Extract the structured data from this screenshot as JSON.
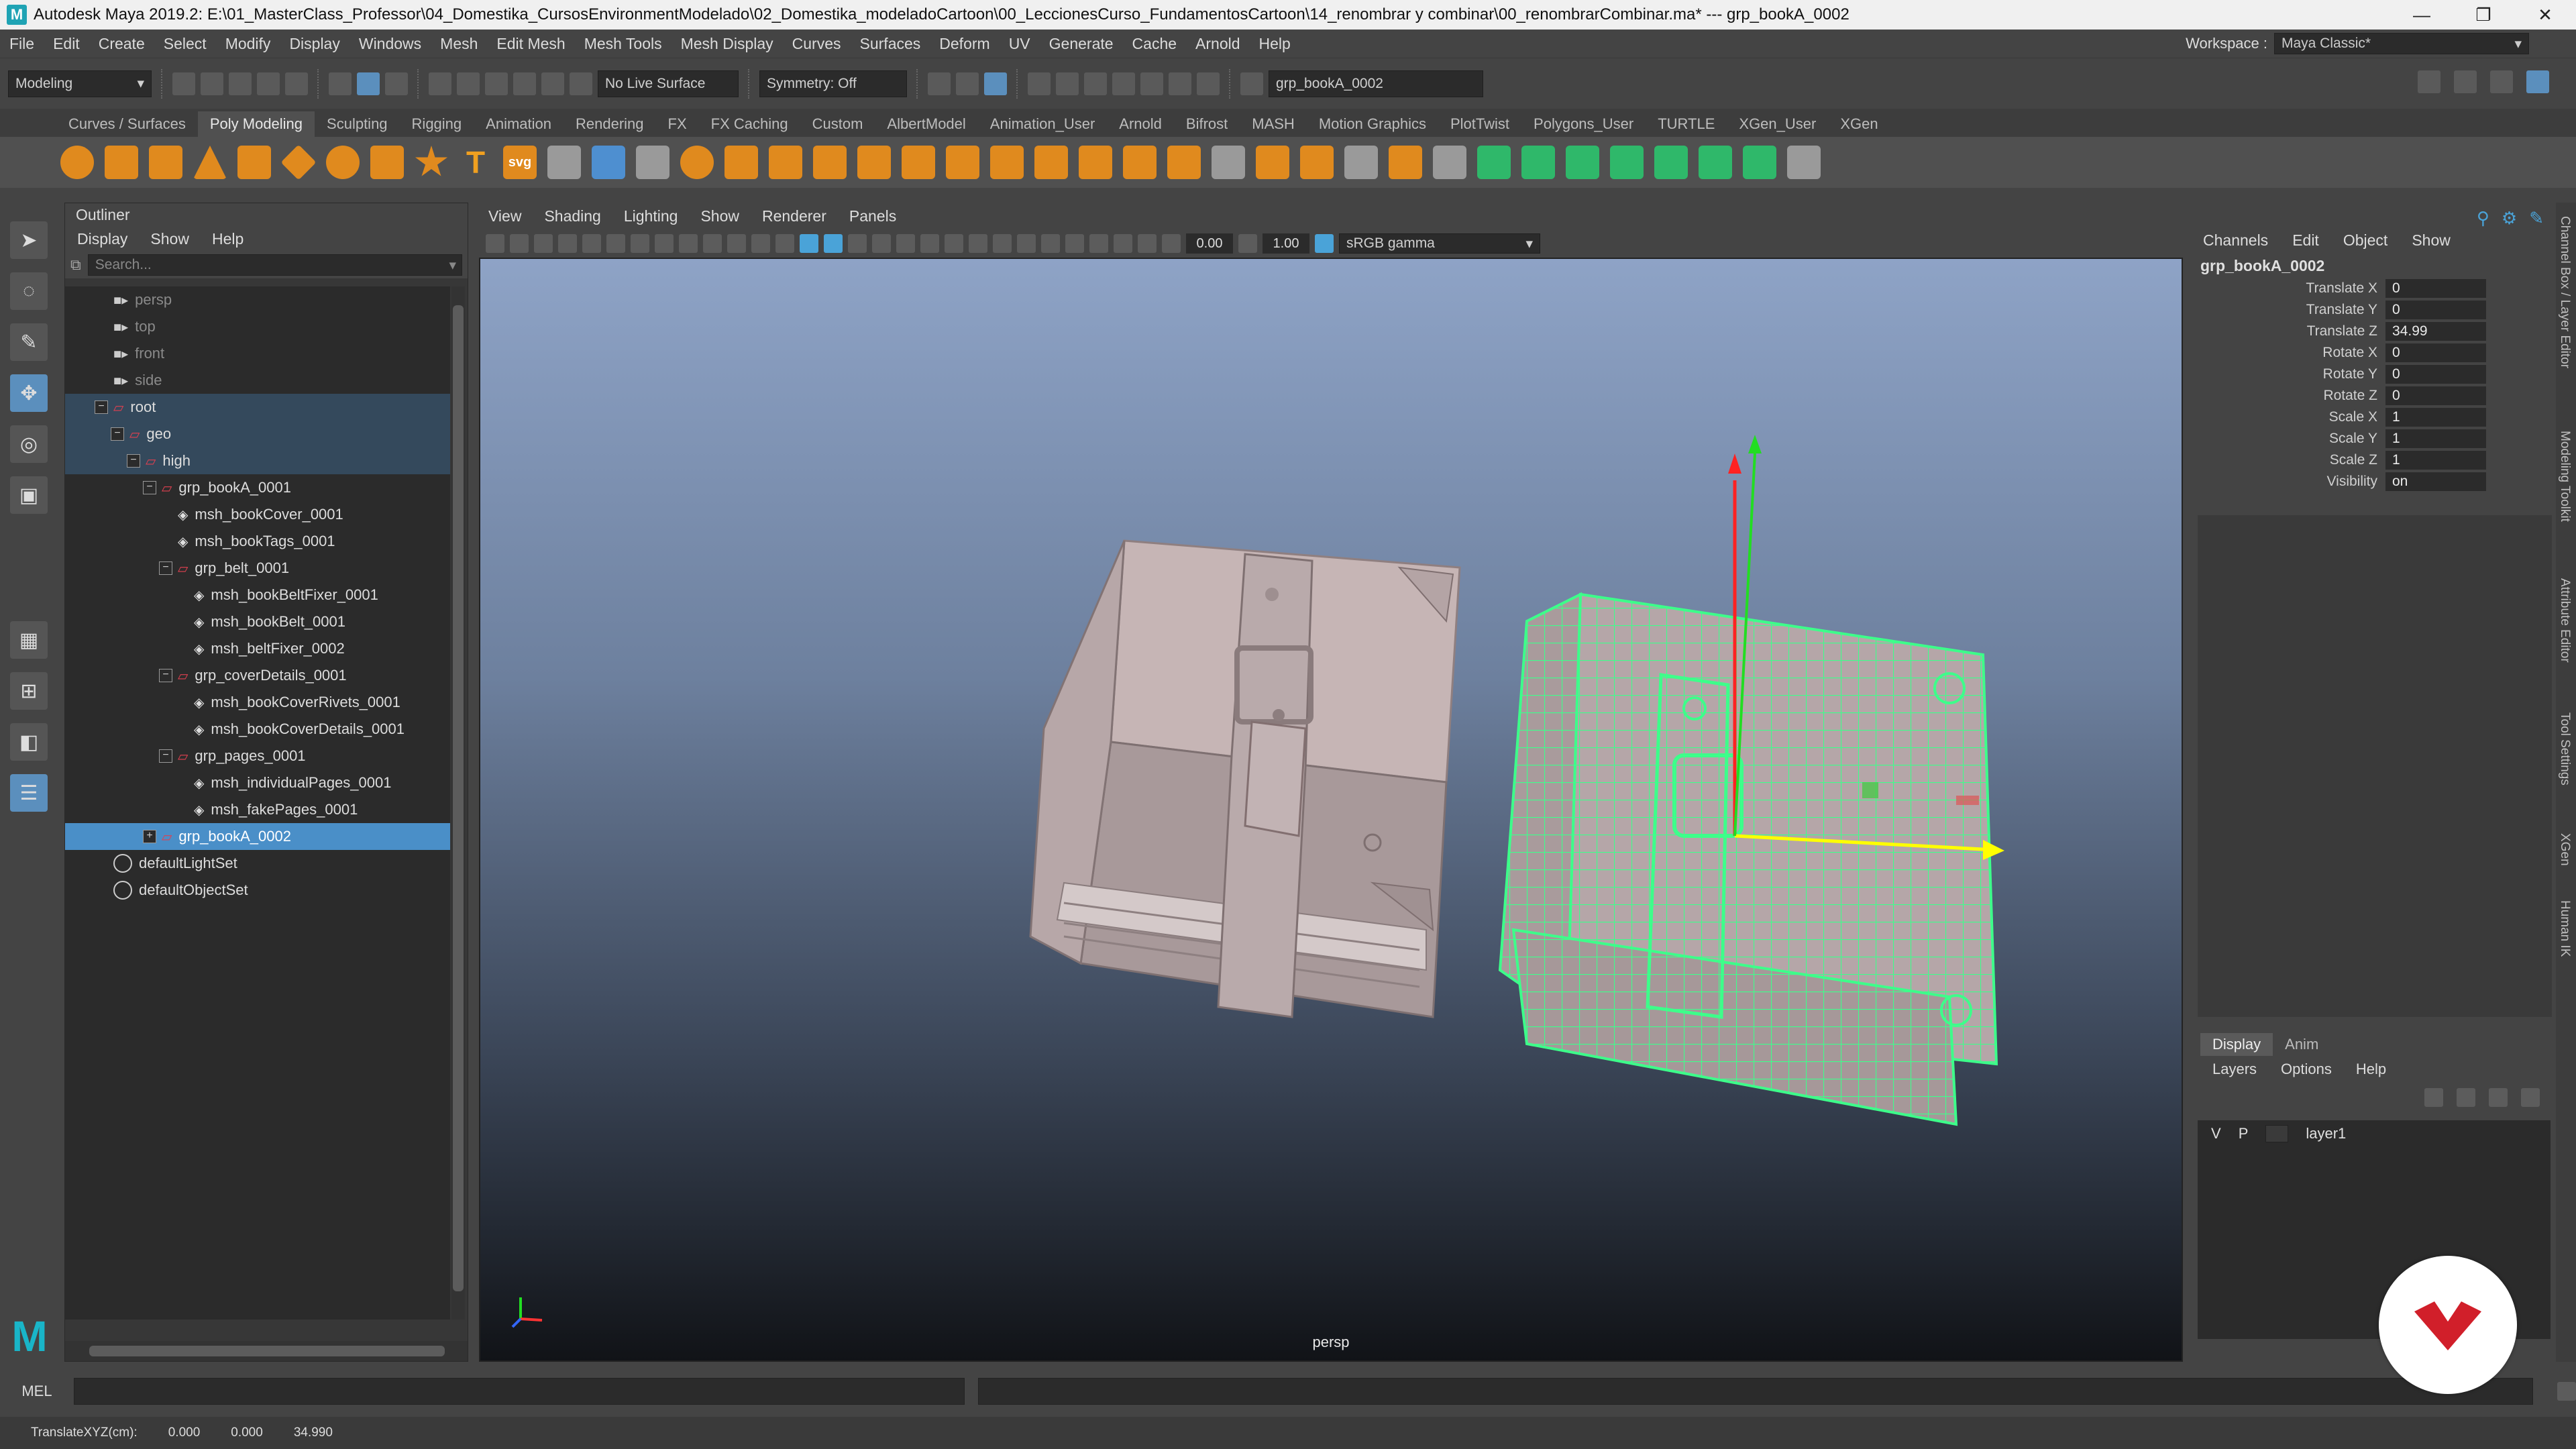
{
  "titlebar": {
    "title": "Autodesk Maya 2019.2: E:\\01_MasterClass_Professor\\04_Domestika_CursosEnvironmentModelado\\02_Domestika_modeladoCartoon\\00_LeccionesCurso_FundamentosCartoon\\14_renombrar y combinar\\00_renombrarCombinar.ma*  ---  grp_bookA_0002",
    "app_icon": "M",
    "minimize": "—",
    "maximize": "❐",
    "close": "✕"
  },
  "menubar": {
    "items": [
      "File",
      "Edit",
      "Create",
      "Select",
      "Modify",
      "Display",
      "Windows",
      "Mesh",
      "Edit Mesh",
      "Mesh Tools",
      "Mesh Display",
      "Curves",
      "Surfaces",
      "Deform",
      "UV",
      "Generate",
      "Cache",
      "Arnold",
      "Help"
    ],
    "workspace_label": "Workspace :",
    "workspace_value": "Maya Classic*"
  },
  "statusline": {
    "mode": "Modeling",
    "live_surface": "No Live Surface",
    "symmetry": "Symmetry: Off",
    "name_field": "grp_bookA_0002"
  },
  "shelf": {
    "tabs": [
      "Curves / Surfaces",
      "Poly Modeling",
      "Sculpting",
      "Rigging",
      "Animation",
      "Rendering",
      "FX",
      "FX Caching",
      "Custom",
      "AlbertModel",
      "Animation_User",
      "Arnold",
      "Bifrost",
      "MASH",
      "Motion Graphics",
      "PlotTwist",
      "Polygons_User",
      "TURTLE",
      "XGen_User",
      "XGen"
    ],
    "active_tab": "Poly Modeling",
    "text_icon": "T",
    "svg_icon": "svg"
  },
  "outliner": {
    "title": "Outliner",
    "menus": [
      "Display",
      "Show",
      "Help"
    ],
    "search_placeholder": "Search...",
    "items": [
      {
        "label": "persp",
        "depth": 0,
        "icon": "camera-icon",
        "dim": true
      },
      {
        "label": "top",
        "depth": 0,
        "icon": "camera-icon",
        "dim": true
      },
      {
        "label": "front",
        "depth": 0,
        "icon": "camera-icon",
        "dim": true
      },
      {
        "label": "side",
        "depth": 0,
        "icon": "camera-icon",
        "dim": true
      },
      {
        "label": "root",
        "depth": 0,
        "icon": "group-icon",
        "expander": "−",
        "hl": true
      },
      {
        "label": "geo",
        "depth": 1,
        "icon": "group-icon",
        "expander": "−",
        "hl": true
      },
      {
        "label": "high",
        "depth": 2,
        "icon": "group-icon",
        "expander": "−",
        "hl": true
      },
      {
        "label": "grp_bookA_0001",
        "depth": 3,
        "icon": "group-icon",
        "expander": "−"
      },
      {
        "label": "msh_bookCover_0001",
        "depth": 4,
        "icon": "mesh-icon"
      },
      {
        "label": "msh_bookTags_0001",
        "depth": 4,
        "icon": "mesh-icon"
      },
      {
        "label": "grp_belt_0001",
        "depth": 4,
        "icon": "group-icon",
        "expander": "−"
      },
      {
        "label": "msh_bookBeltFixer_0001",
        "depth": 5,
        "icon": "mesh-icon"
      },
      {
        "label": "msh_bookBelt_0001",
        "depth": 5,
        "icon": "mesh-icon"
      },
      {
        "label": "msh_beltFixer_0002",
        "depth": 5,
        "icon": "mesh-icon"
      },
      {
        "label": "grp_coverDetails_0001",
        "depth": 4,
        "icon": "group-icon",
        "expander": "−"
      },
      {
        "label": "msh_bookCoverRivets_0001",
        "depth": 5,
        "icon": "mesh-icon"
      },
      {
        "label": "msh_bookCoverDetails_0001",
        "depth": 5,
        "icon": "mesh-icon"
      },
      {
        "label": "grp_pages_0001",
        "depth": 4,
        "icon": "group-icon",
        "expander": "−"
      },
      {
        "label": "msh_individualPages_0001",
        "depth": 5,
        "icon": "mesh-icon"
      },
      {
        "label": "msh_fakePages_0001",
        "depth": 5,
        "icon": "mesh-icon"
      },
      {
        "label": "grp_bookA_0002",
        "depth": 3,
        "icon": "group-icon",
        "expander": "+",
        "selected": true
      },
      {
        "label": "defaultLightSet",
        "depth": 0,
        "icon": "set-icon"
      },
      {
        "label": "defaultObjectSet",
        "depth": 0,
        "icon": "set-icon"
      }
    ]
  },
  "viewport": {
    "menus": [
      "View",
      "Shading",
      "Lighting",
      "Show",
      "Renderer",
      "Panels"
    ],
    "exposure": "0.00",
    "gamma": "1.00",
    "color_space": "sRGB gamma",
    "camera_label": "persp"
  },
  "channelbox": {
    "menus": [
      "Channels",
      "Edit",
      "Object",
      "Show"
    ],
    "object_name": "grp_bookA_0002",
    "channels": [
      {
        "label": "Translate X",
        "value": "0"
      },
      {
        "label": "Translate Y",
        "value": "0"
      },
      {
        "label": "Translate Z",
        "value": "34.99"
      },
      {
        "label": "Rotate X",
        "value": "0"
      },
      {
        "label": "Rotate Y",
        "value": "0"
      },
      {
        "label": "Rotate Z",
        "value": "0"
      },
      {
        "label": "Scale X",
        "value": "1"
      },
      {
        "label": "Scale Y",
        "value": "1"
      },
      {
        "label": "Scale Z",
        "value": "1"
      },
      {
        "label": "Visibility",
        "value": "on"
      }
    ]
  },
  "side_tabs": [
    "Channel Box / Layer Editor",
    "Modeling Toolkit",
    "Attribute Editor",
    "Tool Settings",
    "XGen",
    "Human IK"
  ],
  "layer_editor": {
    "tabs": [
      "Display",
      "Anim"
    ],
    "menus": [
      "Layers",
      "Options",
      "Help"
    ],
    "layers": [
      {
        "v": "V",
        "p": "P",
        "name": "layer1"
      }
    ]
  },
  "cmdline": {
    "language": "MEL"
  },
  "helpline": {
    "label": "TranslateXYZ(cm):",
    "x": "0.000",
    "y": "0.000",
    "z": "34.990"
  },
  "colors": {
    "wireframe": "#3dff8a",
    "selection": "#4a8fc8",
    "maya_teal": "#19b5c8",
    "brand_red": "#d11f2a"
  }
}
